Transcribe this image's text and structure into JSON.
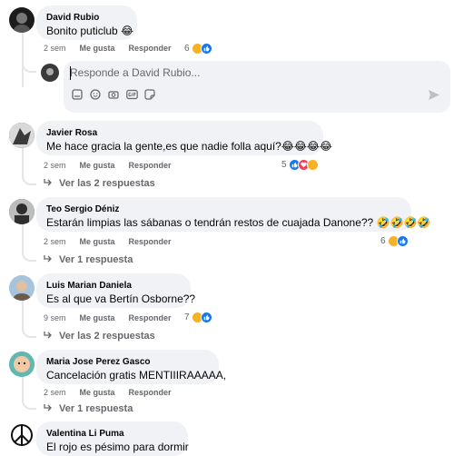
{
  "comments": [
    {
      "author": "David Rubio",
      "text": "Bonito puticlub 😂",
      "time": "2 sem",
      "like": "Me gusta",
      "reply": "Responder",
      "reactions": "6"
    },
    {
      "author": "Javier Rosa",
      "text": "Me hace gracia la gente,es que nadie folla aquí?😂😂😂😂",
      "time": "2 sem",
      "like": "Me gusta",
      "reply": "Responder",
      "reactions": "5",
      "replies": "Ver las 2 respuestas"
    },
    {
      "author": "Teo Sergio Déniz",
      "text": "Estarán limpias las sábanas o tendrán restos de cuajada Danone?? 🤣🤣🤣🤣",
      "time": "2 sem",
      "like": "Me gusta",
      "reply": "Responder",
      "reactions": "6",
      "replies": "Ver 1 respuesta"
    },
    {
      "author": "Luis Marian Daniela",
      "text": "Es al que va Bertín Osborne??",
      "time": "9 sem",
      "like": "Me gusta",
      "reply": "Responder",
      "reactions": "7",
      "replies": "Ver las 2 respuestas"
    },
    {
      "author": "Maria Jose Perez Gasco",
      "text": "Cancelación gratis MENTIIIRAAAAA,",
      "time": "2 sem",
      "like": "Me gusta",
      "reply": "Responder",
      "replies": "Ver 1 respuesta"
    },
    {
      "author": "Valentina Li Puma",
      "text": "El rojo es pésimo para dormir"
    }
  ],
  "reply_box": {
    "placeholder": "Responde a David Rubio..."
  },
  "colors": {
    "like": "#1877f2",
    "love": "#f33e58",
    "haha": "#f7b125",
    "bubble": "#f0f2f5",
    "meta": "#65676b"
  }
}
